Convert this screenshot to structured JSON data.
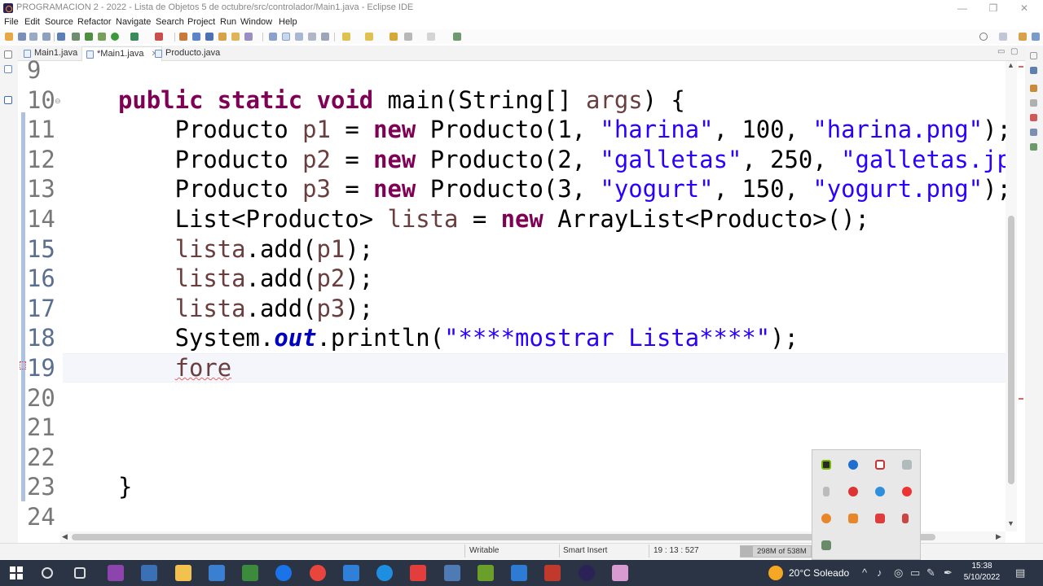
{
  "window": {
    "title": "PROGRAMACION 2 - 2022 - Lista de Objetos 5 de octubre/src/controlador/Main1.java - Eclipse IDE",
    "minimize": "—",
    "maximize": "❐",
    "close": "✕"
  },
  "menu": [
    "File",
    "Edit",
    "Source",
    "Refactor",
    "Navigate",
    "Search",
    "Project",
    "Run",
    "Window",
    "Help"
  ],
  "tabs": [
    {
      "label": "Main1.java",
      "close": ""
    },
    {
      "label": "*Main1.java",
      "close": "✕"
    },
    {
      "label": "Producto.java",
      "close": ""
    }
  ],
  "editor": {
    "lines": [
      {
        "n": "9",
        "html": ""
      },
      {
        "n": "10",
        "html": "<span class=\"kw\">public</span> <span class=\"kw\">static</span> <span class=\"kw\">void</span> main(String[] <span class=\"var\">args</span>) {"
      },
      {
        "n": "11",
        "html": "    Producto <span class=\"var\">p1</span> = <span class=\"kw\">new</span> Producto(1, <span class=\"str\">\"harina\"</span>, 100, <span class=\"str\">\"harina.png\"</span>);"
      },
      {
        "n": "12",
        "html": "    Producto <span class=\"var\">p2</span> = <span class=\"kw\">new</span> Producto(2, <span class=\"str\">\"galletas\"</span>, 250, <span class=\"str\">\"galletas.jp</span>"
      },
      {
        "n": "13",
        "html": "    Producto <span class=\"var\">p3</span> = <span class=\"kw\">new</span> Producto(3, <span class=\"str\">\"yogurt\"</span>, 150, <span class=\"str\">\"yogurt.png\"</span>);"
      },
      {
        "n": "14",
        "html": "    List&lt;Producto&gt; <span class=\"var\">lista</span> = <span class=\"kw\">new</span> ArrayList&lt;Producto&gt;();"
      },
      {
        "n": "15",
        "html": "    <span class=\"var\">lista</span>.add(<span class=\"var\">p1</span>);"
      },
      {
        "n": "16",
        "html": "    <span class=\"var\">lista</span>.add(<span class=\"var\">p2</span>);"
      },
      {
        "n": "17",
        "html": "    <span class=\"var\">lista</span>.add(<span class=\"var\">p3</span>);"
      },
      {
        "n": "18",
        "html": "    System.<span class=\"fld\">out</span>.println(<span class=\"str\">\"****mostrar Lista****\"</span>);"
      },
      {
        "n": "19",
        "html": "    <span class=\"var err\">fore</span>"
      },
      {
        "n": "20",
        "html": ""
      },
      {
        "n": "21",
        "html": ""
      },
      {
        "n": "22",
        "html": ""
      },
      {
        "n": "23",
        "html": "}"
      },
      {
        "n": "24",
        "html": ""
      }
    ]
  },
  "status": {
    "writable": "Writable",
    "insert_mode": "Smart Insert",
    "position": "19 : 13 : 527",
    "heap": "298M of 538M"
  },
  "taskbar": {
    "weather": "20°C Soleado",
    "time": "15:38",
    "date": "5/10/2022"
  },
  "colors": {
    "keyword": "#7f0055",
    "string": "#2a00ff",
    "local_variable": "#6a3e3e",
    "static_field": "#0000c0",
    "taskbar": "#2b3445"
  }
}
